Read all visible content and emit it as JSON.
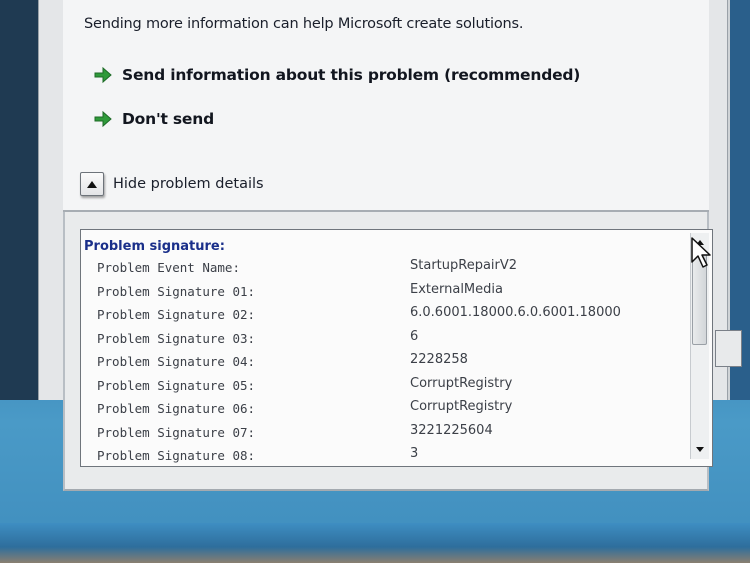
{
  "dialog": {
    "intro_text": "Sending more information can help Microsoft create solutions.",
    "options": [
      {
        "label": "Send information about this problem (recommended)",
        "icon": "green-arrow-icon"
      },
      {
        "label": "Don't send",
        "icon": "green-arrow-icon"
      }
    ],
    "details_toggle": {
      "label": "Hide problem details",
      "icon": "triangle-up-icon"
    },
    "details": {
      "header": "Problem signature:",
      "rows": [
        {
          "label": "Problem Event Name:",
          "value": "StartupRepairV2"
        },
        {
          "label": "Problem Signature 01:",
          "value": "ExternalMedia"
        },
        {
          "label": "Problem Signature 02:",
          "value": "6.0.6001.18000.6.0.6001.18000"
        },
        {
          "label": "Problem Signature 03:",
          "value": "6"
        },
        {
          "label": "Problem Signature 04:",
          "value": "2228258"
        },
        {
          "label": "Problem Signature 05:",
          "value": "CorruptRegistry"
        },
        {
          "label": "Problem Signature 06:",
          "value": "CorruptRegistry"
        },
        {
          "label": "Problem Signature 07:",
          "value": "3221225604"
        },
        {
          "label": "Problem Signature 08:",
          "value": "3"
        }
      ]
    }
  },
  "colors": {
    "header_blue": "#1a2f8a",
    "arrow_green": "#2f9a3a",
    "desktop_blue": "#2d77a7"
  }
}
